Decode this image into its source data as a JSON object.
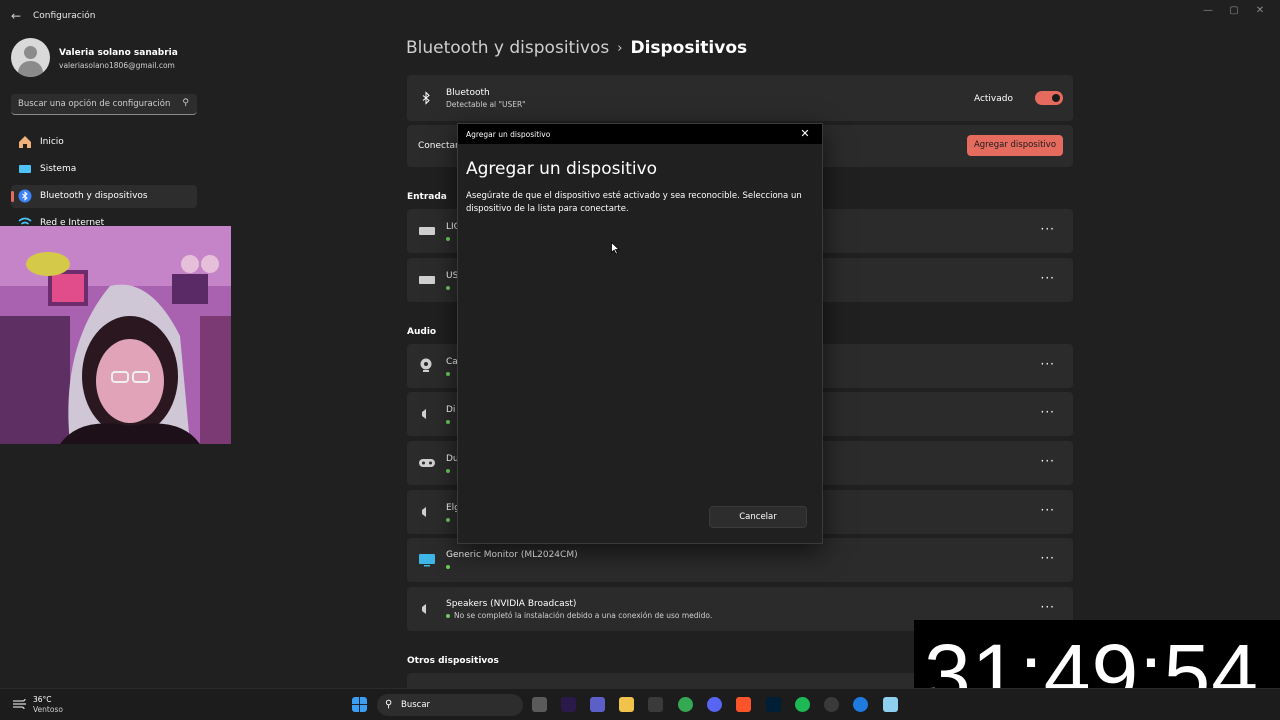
{
  "window": {
    "title": "Configuración",
    "back_icon": "back-arrow-icon"
  },
  "user": {
    "name": "Valeria solano sanabria",
    "email": "valeriasolano1806@gmail.com"
  },
  "search": {
    "placeholder": "Buscar una opción de configuración"
  },
  "sidebar": {
    "items": [
      {
        "label": "Inicio",
        "icon": "home-icon"
      },
      {
        "label": "Sistema",
        "icon": "system-icon"
      },
      {
        "label": "Bluetooth y dispositivos",
        "icon": "bluetooth-icon",
        "active": true
      },
      {
        "label": "Red e Internet",
        "icon": "wifi-icon"
      }
    ]
  },
  "breadcrumb": {
    "parent": "Bluetooth y dispositivos",
    "separator": "›",
    "current": "Dispositivos"
  },
  "bluetooth": {
    "title": "Bluetooth",
    "subtitle": "Detectable al \"USER\"",
    "toggle_label": "Activado",
    "toggle_on": true
  },
  "connect_card": {
    "label": "Conectar",
    "button": "Agregar dispositivo"
  },
  "sections": {
    "input": "Entrada",
    "audio": "Audio",
    "other": "Otros dispositivos"
  },
  "input_devices": [
    {
      "name": "LIG",
      "icon": "keyboard-icon"
    },
    {
      "name": "US",
      "icon": "keyboard-icon"
    }
  ],
  "audio_devices": [
    {
      "name": "Ca",
      "icon": "webcam-icon",
      "status": ""
    },
    {
      "name": "Di",
      "icon": "speaker-icon",
      "status": ""
    },
    {
      "name": "Du",
      "icon": "gamepad-icon",
      "status": ""
    },
    {
      "name": "Elg",
      "icon": "speaker-icon",
      "status": ""
    },
    {
      "name": "Generic Monitor (ML2024CM)",
      "icon": "monitor-icon",
      "status": ""
    },
    {
      "name": "Speakers (NVIDIA Broadcast)",
      "icon": "speaker-icon",
      "status": "No se completó la instalación debido a una conexión de uso medido."
    }
  ],
  "more_label": "···",
  "dialog": {
    "window_title": "Agregar un dispositivo",
    "heading": "Agregar un dispositivo",
    "text": "Asegúrate de que el dispositivo esté activado y sea reconocible. Selecciona un dispositivo de la lista para conectarte.",
    "cancel": "Cancelar"
  },
  "timer": {
    "value": "31:49:54"
  },
  "taskbar": {
    "weather_temp": "36°C",
    "weather_desc": "Ventoso",
    "search_placeholder": "Buscar",
    "apps": [
      "windows-start-icon",
      "file-explorer-icon",
      "premiere-icon",
      "teams-icon",
      "folder-icon",
      "store-icon",
      "chrome-icon",
      "discord-icon",
      "brave-icon",
      "photoshop-icon",
      "spotify-icon",
      "obs-icon",
      "edge-icon",
      "remote-desktop-icon",
      "settings-icon"
    ]
  },
  "colors": {
    "accent": "#e56b5e",
    "background": "#202020",
    "card": "#2b2b2b",
    "status_green": "#6ccb5f"
  }
}
